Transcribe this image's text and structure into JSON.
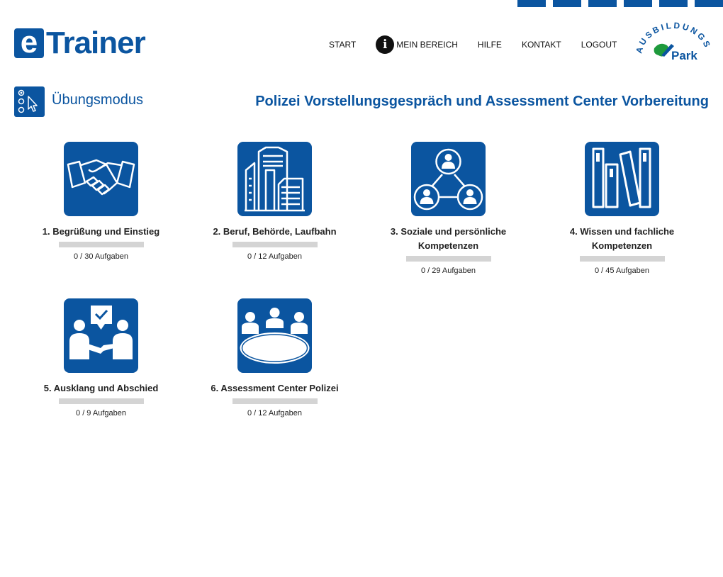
{
  "header": {
    "logo_e": "e",
    "logo_text": "Trainer",
    "nav": [
      {
        "label": "START"
      },
      {
        "label": "MEIN BEREICH",
        "icon": "info-icon"
      },
      {
        "label": "HILFE"
      },
      {
        "label": "KONTAKT"
      },
      {
        "label": "LOGOUT"
      }
    ],
    "partner_logo": {
      "top_text": "AUSBILDUNGS",
      "bottom_text": "Park"
    }
  },
  "page": {
    "mode_icon": "cursor-list-icon",
    "mode_title": "Übungsmodus",
    "course_title": "Polizei Vorstellungsgespräch und Assessment Center Vorbereitung"
  },
  "categories": [
    {
      "label": "1. Begrüßung und Einstieg",
      "icon": "handshake-icon",
      "done": 0,
      "total": 30,
      "count_text": "0 / 30 Aufgaben",
      "progress": 0
    },
    {
      "label": "2. Beruf, Behörde, Laufbahn",
      "icon": "buildings-icon",
      "done": 0,
      "total": 12,
      "count_text": "0 / 12 Aufgaben",
      "progress": 0
    },
    {
      "label": "3. Soziale und persönliche Kompetenzen",
      "icon": "network-people-icon",
      "done": 0,
      "total": 29,
      "count_text": "0 / 29 Aufgaben",
      "progress": 0
    },
    {
      "label": "4. Wissen und fachliche Kompetenzen",
      "icon": "books-icon",
      "done": 0,
      "total": 45,
      "count_text": "0 / 45 Aufgaben",
      "progress": 0
    },
    {
      "label": "5. Ausklang und Abschied",
      "icon": "meeting-handshake-icon",
      "done": 0,
      "total": 9,
      "count_text": "0 / 9 Aufgaben",
      "progress": 0
    },
    {
      "label": "6. Assessment Center Polizei",
      "icon": "round-table-icon",
      "done": 0,
      "total": 12,
      "count_text": "0 / 12 Aufgaben",
      "progress": 0
    }
  ],
  "colors": {
    "brand_blue": "#0b55a0",
    "progress_track": "#d4d4d4",
    "partner_green": "#1e9a3c"
  }
}
